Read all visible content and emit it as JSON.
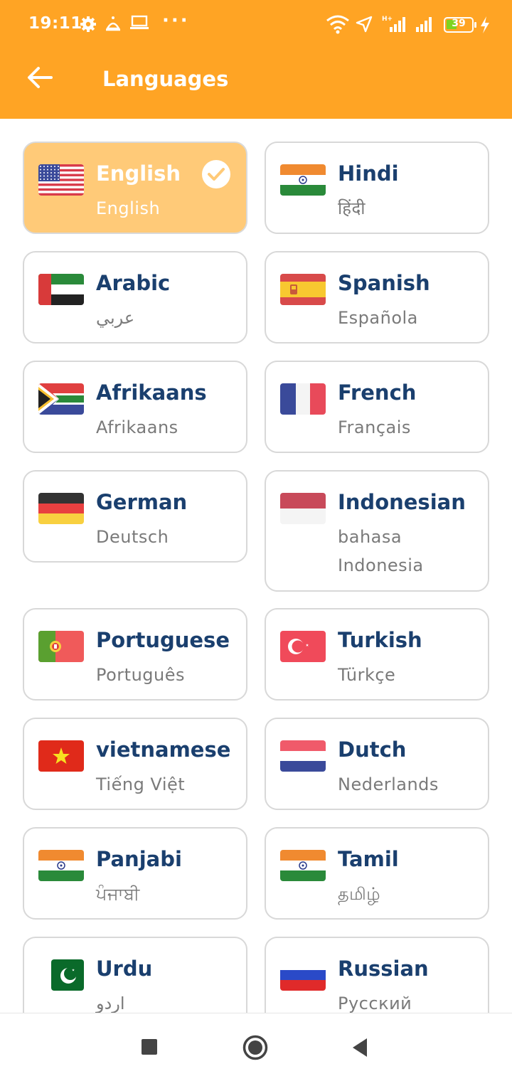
{
  "status_bar": {
    "time": "19:11",
    "battery_level": "39",
    "icons": [
      "gear-icon",
      "alarm-icon",
      "laptop-icon",
      "more-dots-icon",
      "wifi-icon",
      "location-arrow-icon",
      "signal-icon",
      "signal-icon",
      "battery-icon",
      "charging-icon"
    ]
  },
  "header": {
    "title": "Languages",
    "back_icon": "arrow-left-icon",
    "background": "#ffa424"
  },
  "colors": {
    "accent": "#ffa424",
    "selected_card": "#ffca78",
    "language_name": "#1a3f6e",
    "native_name": "#7a7a7a"
  },
  "languages": [
    {
      "name": "English",
      "native": "English",
      "flag": "us-flag-icon",
      "selected": true
    },
    {
      "name": "Hindi",
      "native": "हिंदी",
      "flag": "india-flag-icon",
      "selected": false
    },
    {
      "name": "Arabic",
      "native": "عربي",
      "flag": "uae-flag-icon",
      "selected": false
    },
    {
      "name": "Spanish",
      "native": "Española",
      "flag": "spain-flag-icon",
      "selected": false
    },
    {
      "name": "Afrikaans",
      "native": "Afrikaans",
      "flag": "south-africa-flag-icon",
      "selected": false
    },
    {
      "name": "French",
      "native": "Français",
      "flag": "france-flag-icon",
      "selected": false
    },
    {
      "name": "German",
      "native": "Deutsch",
      "flag": "germany-flag-icon",
      "selected": false
    },
    {
      "name": "Indonesian",
      "native": "bahasa Indonesia",
      "flag": "indonesia-flag-icon",
      "selected": false
    },
    {
      "name": "Portuguese",
      "native": "Português",
      "flag": "portugal-flag-icon",
      "selected": false
    },
    {
      "name": "Turkish",
      "native": "Türkçe",
      "flag": "turkey-flag-icon",
      "selected": false
    },
    {
      "name": "vietnamese",
      "native": "Tiếng Việt",
      "flag": "vietnam-flag-icon",
      "selected": false
    },
    {
      "name": "Dutch",
      "native": "Nederlands",
      "flag": "netherlands-flag-icon",
      "selected": false
    },
    {
      "name": "Panjabi",
      "native": "ਪੰਜਾਬੀ",
      "flag": "india-flag-icon",
      "selected": false
    },
    {
      "name": "Tamil",
      "native": "தமிழ்",
      "flag": "india-flag-icon",
      "selected": false
    },
    {
      "name": "Urdu",
      "native": "اردو",
      "flag": "pakistan-flag-icon",
      "selected": false
    },
    {
      "name": "Russian",
      "native": "Русский",
      "flag": "russia-flag-icon",
      "selected": false
    }
  ],
  "nav_bar": {
    "icons": [
      "recents-square-icon",
      "home-circle-icon",
      "back-triangle-icon"
    ]
  }
}
